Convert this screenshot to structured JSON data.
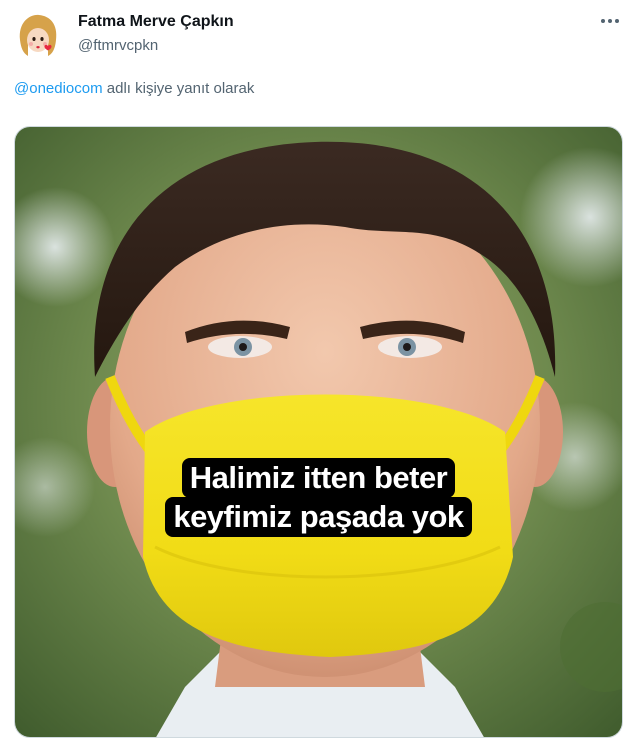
{
  "tweet": {
    "author": {
      "display_name": "Fatma Merve Çapkın",
      "handle": "@ftmrvcpkn",
      "avatar_icon": "cartoon-avatar-icon"
    },
    "more_icon": "more-dots-icon",
    "reply_context": {
      "mention": "@onediocom",
      "suffix": " adlı kişiye yanıt olarak"
    },
    "media": {
      "caption_line1": "Halimiz itten beter",
      "caption_line2": "keyfimiz paşada yok",
      "mask_color": "#f4df1a",
      "caption_bg": "#000000"
    }
  },
  "colors": {
    "link": "#1d9bf0",
    "secondary_text": "#536471",
    "primary_text": "#0f1419"
  }
}
